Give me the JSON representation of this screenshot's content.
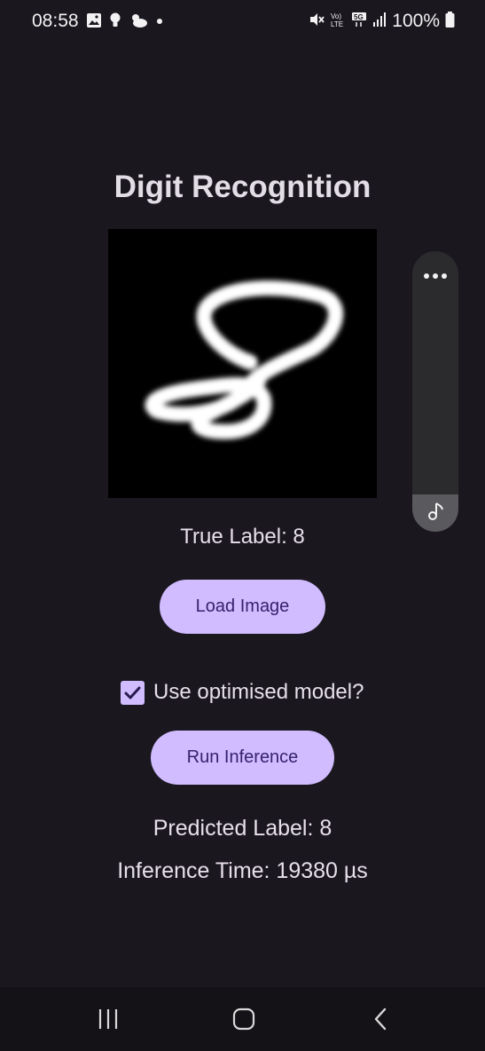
{
  "status": {
    "time": "08:58",
    "battery": "100%",
    "left_icons": [
      "image-icon",
      "bulb-icon",
      "weather-icon",
      "dot-icon"
    ],
    "right_icons": [
      "mute-icon",
      "volte-icon",
      "5g-icon",
      "signal-icon",
      "battery-icon"
    ]
  },
  "app": {
    "title": "Digit Recognition",
    "true_label": "True Label: 8",
    "load_button": "Load Image",
    "optimised_checkbox_label": "Use optimised model?",
    "optimised_checked": true,
    "run_button": "Run Inference",
    "predicted_label": "Predicted Label: 8",
    "inference_time": "Inference Time: 19380 µs"
  },
  "side_panel": {
    "menu_icon": "more-horizontal-icon",
    "bottom_icon": "music-note-icon"
  },
  "nav": {
    "items": [
      "recents-icon",
      "home-icon",
      "back-icon"
    ]
  }
}
